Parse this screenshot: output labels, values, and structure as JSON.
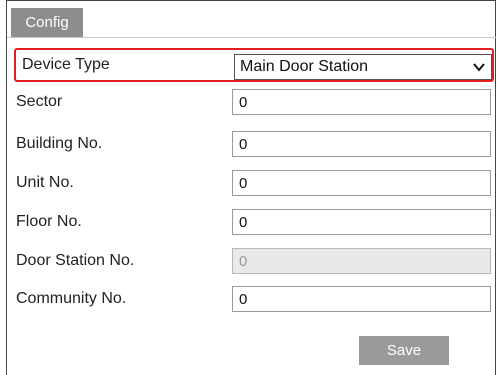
{
  "tabs": [
    {
      "label": "Config"
    }
  ],
  "form": {
    "device_type": {
      "label": "Device Type",
      "value": "Main Door Station"
    },
    "sector": {
      "label": "Sector",
      "value": "0"
    },
    "building_no": {
      "label": "Building No.",
      "value": "0"
    },
    "unit_no": {
      "label": "Unit No.",
      "value": "0"
    },
    "floor_no": {
      "label": "Floor No.",
      "value": "0"
    },
    "door_station_no": {
      "label": "Door Station No.",
      "value": "0"
    },
    "community_no": {
      "label": "Community No.",
      "value": "0"
    }
  },
  "actions": {
    "save_label": "Save"
  },
  "colors": {
    "highlight": "#e02020",
    "tab_bg": "#8d8d8d",
    "button_bg": "#9a9a9a"
  },
  "icons": {
    "select_arrow": "chevron-down-icon"
  }
}
